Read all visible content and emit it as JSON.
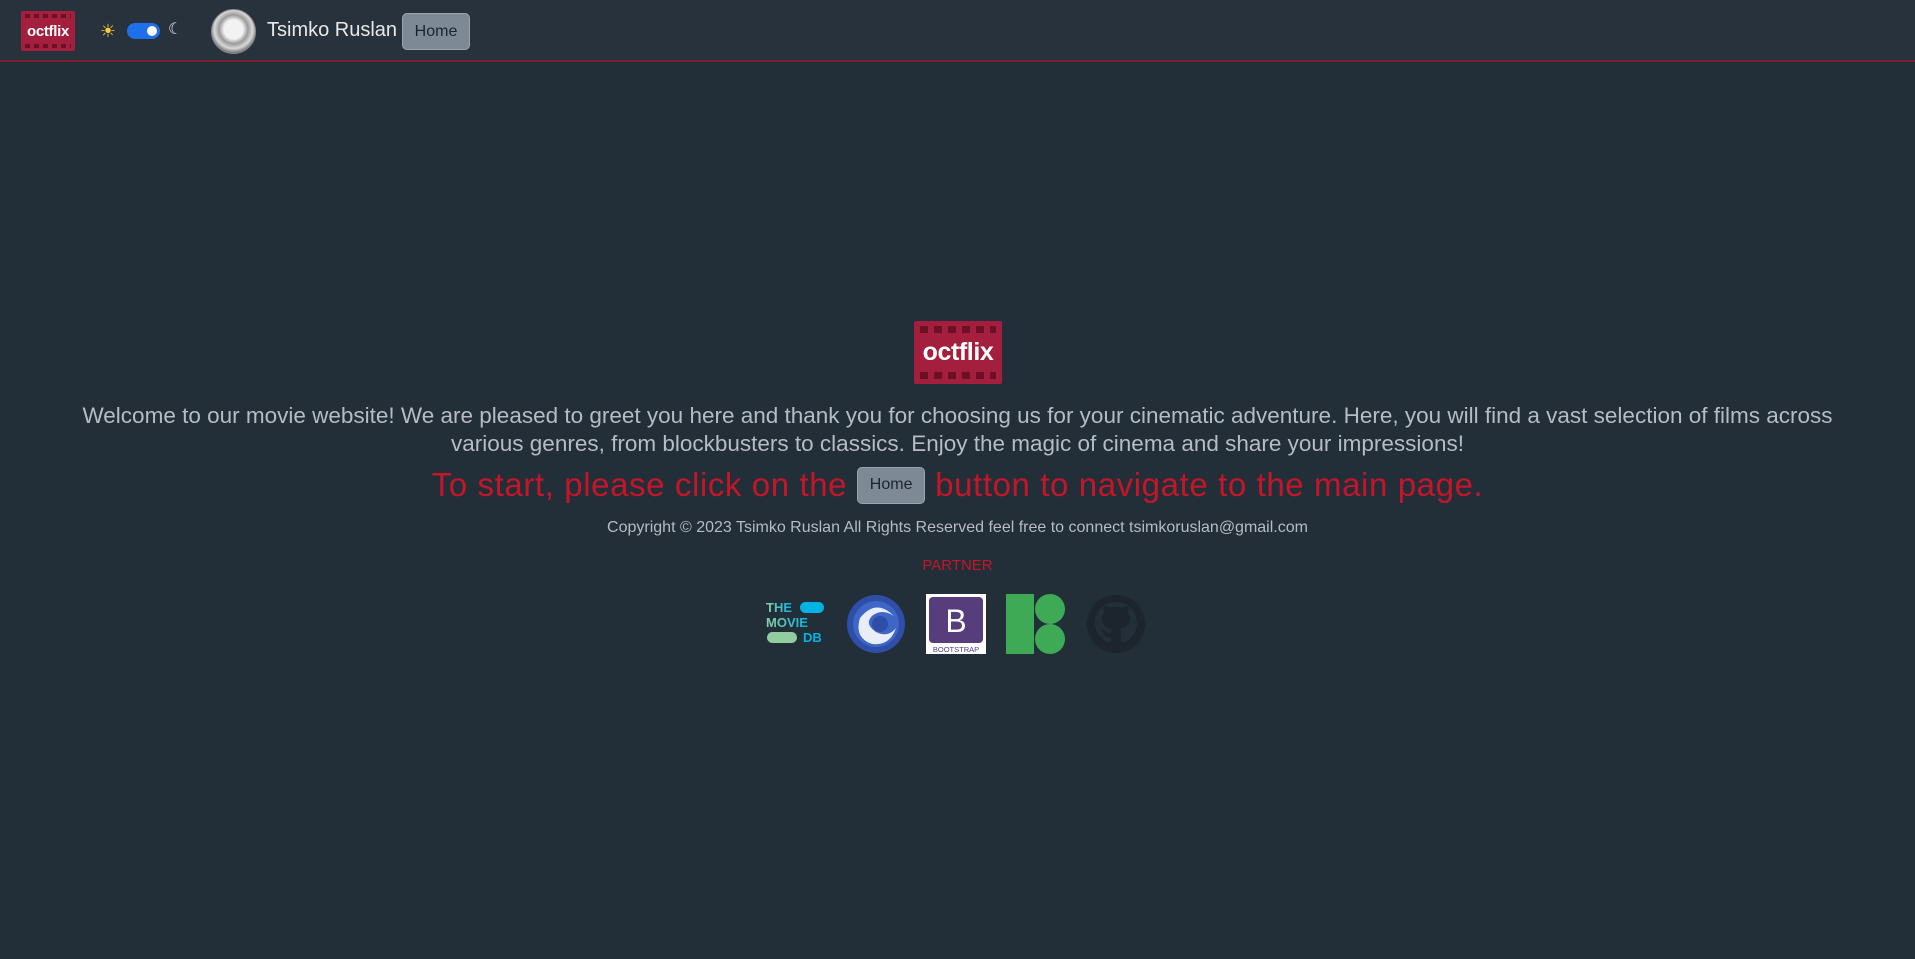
{
  "navbar": {
    "logo_text": "octflix",
    "theme_toggle": {
      "on": true,
      "accent": "#1f6feb"
    },
    "user_name": "Tsimko Ruslan",
    "home_label": "Home"
  },
  "hero": {
    "logo_text": "octflix",
    "welcome": "Welcome to our movie website! We are pleased to greet you here and thank you for choosing us for your cinematic adventure. Here, you will find a vast selection of films across various genres, from blockbusters to classics. Enjoy the magic of cinema and share your impressions!",
    "cta_before": "To start, please click on the",
    "cta_button": "Home",
    "cta_after": "button to navigate to the main page."
  },
  "footer": {
    "copyright": "Copyright © 2023 Tsimko Ruslan All Rights Reserved feel free to connect tsimkoruslan@gmail.com",
    "partner_label": "PARTNER",
    "partners": [
      {
        "name": "tmdb-icon",
        "lines": [
          "THE",
          "MOVIE",
          "DB"
        ]
      },
      {
        "name": "swirl-icon"
      },
      {
        "name": "bootstrap-icon",
        "letter": "B",
        "caption": "BOOTSTRAP"
      },
      {
        "name": "icons8-icon"
      },
      {
        "name": "github-icon"
      }
    ]
  },
  "colors": {
    "background": "#222e38",
    "brand": "#a31f3d",
    "accent_red": "#c51529"
  }
}
